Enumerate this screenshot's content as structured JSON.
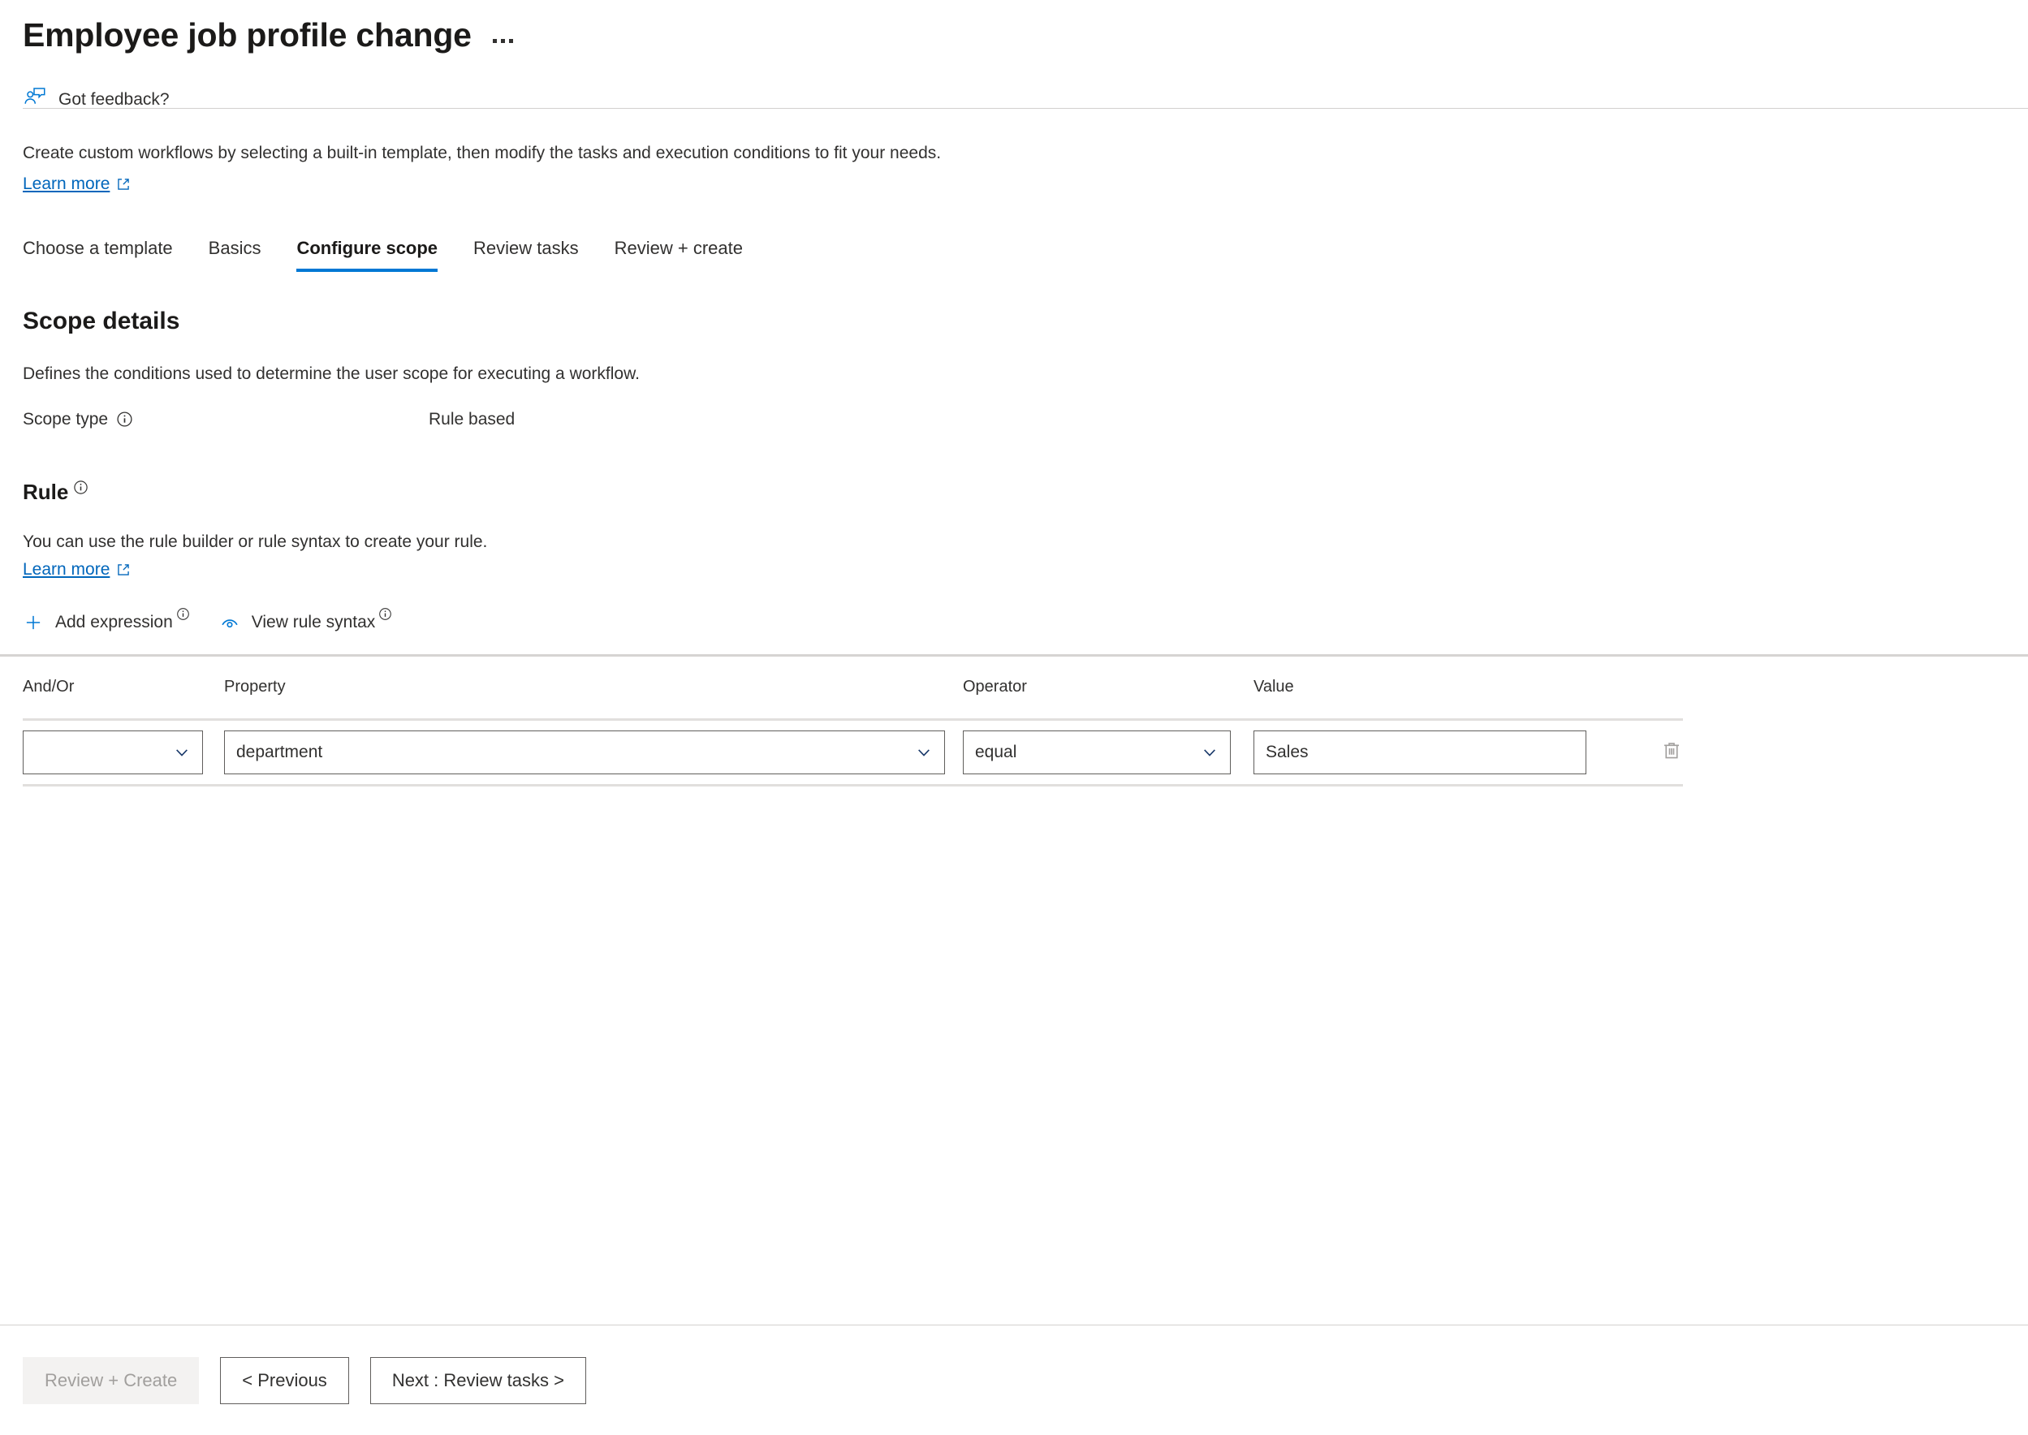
{
  "header": {
    "title": "Employee job profile change",
    "more_menu": "…",
    "more_menu_name": "more-options"
  },
  "feedback": {
    "label": "Got feedback?",
    "icon": "person-feedback-icon"
  },
  "intro": {
    "description": "Create custom workflows by selecting a built-in template, then modify the tasks and execution conditions to fit your needs.",
    "learn_more": "Learn more"
  },
  "tabs": [
    {
      "label": "Choose a template",
      "active": false
    },
    {
      "label": "Basics",
      "active": false
    },
    {
      "label": "Configure scope",
      "active": true
    },
    {
      "label": "Review tasks",
      "active": false
    },
    {
      "label": "Review + create",
      "active": false
    }
  ],
  "scope": {
    "heading": "Scope details",
    "description": "Defines the conditions used to determine the user scope for executing a workflow.",
    "scope_type_label": "Scope type",
    "scope_type_value": "Rule based"
  },
  "rule": {
    "heading": "Rule",
    "description": "You can use the rule builder or rule syntax to create your rule.",
    "learn_more": "Learn more",
    "add_expression": "Add expression",
    "view_rule_syntax": "View rule syntax",
    "columns": {
      "andor": "And/Or",
      "property": "Property",
      "operator": "Operator",
      "value": "Value"
    },
    "rows": [
      {
        "andor": "",
        "property": "department",
        "operator": "equal",
        "value": "Sales",
        "delete_icon": "trash-icon"
      }
    ]
  },
  "footer": {
    "review_create": "Review + Create",
    "previous": "< Previous",
    "next": "Next : Review tasks >"
  },
  "colors": {
    "accent": "#0078d4",
    "link": "#0066bb",
    "text": "#323130",
    "border": "#605e5c",
    "divider": "#d2d0ce",
    "disabled_bg": "#f3f2f1",
    "disabled_text": "#a19f9d"
  }
}
